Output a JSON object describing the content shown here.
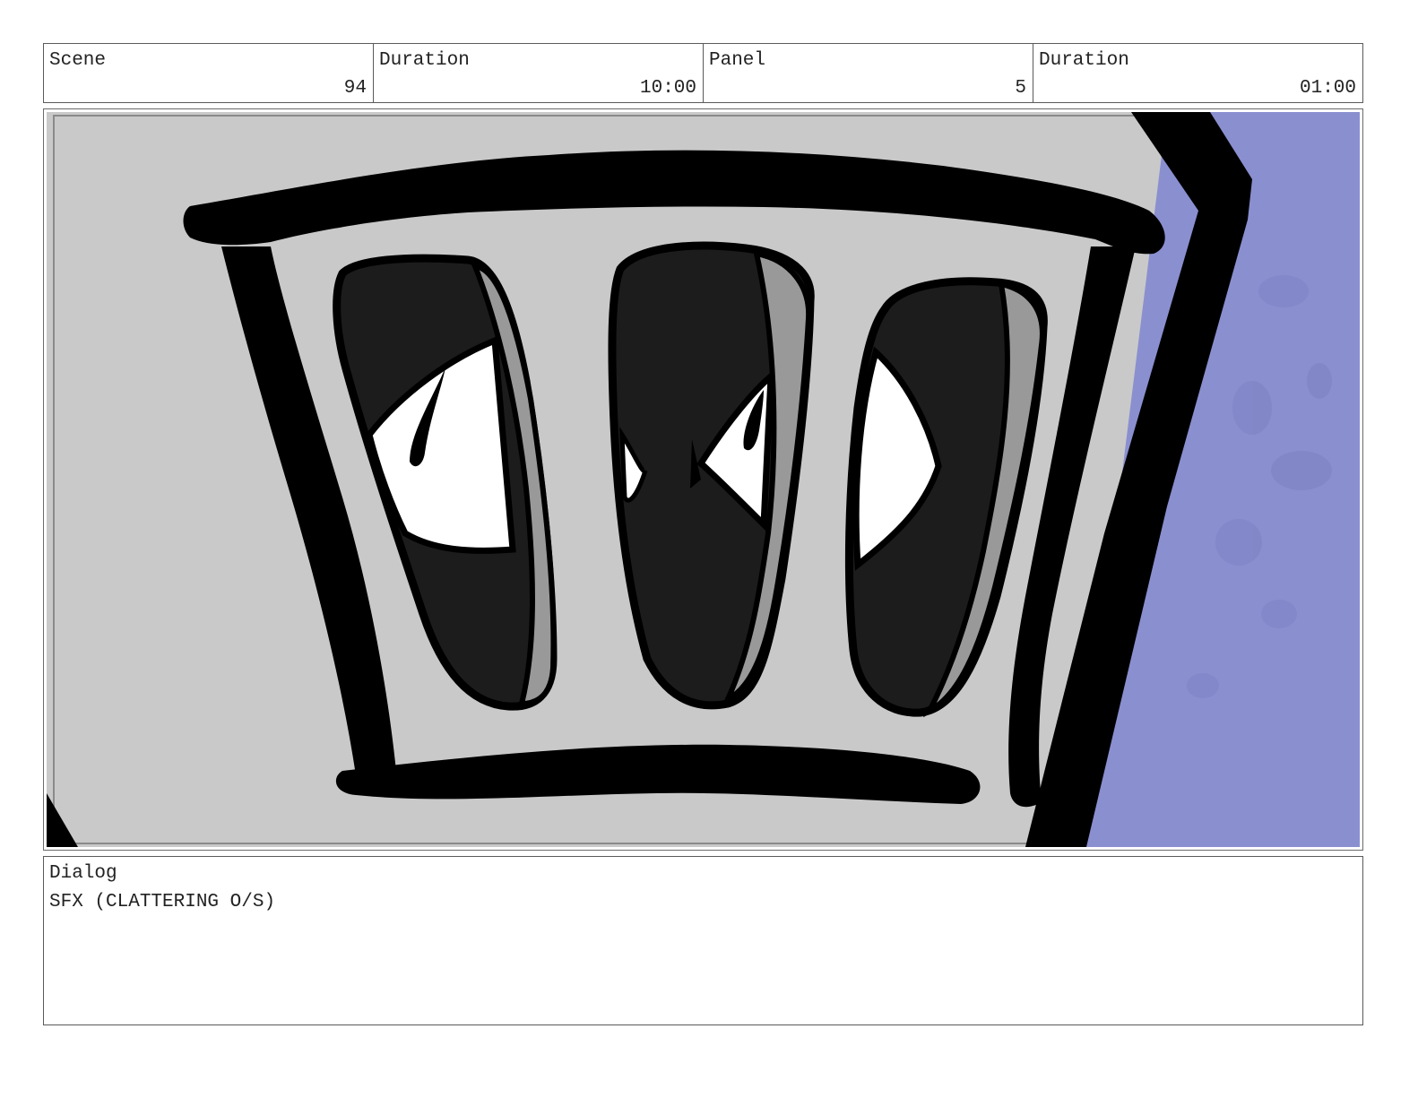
{
  "header": {
    "scene": {
      "label": "Scene",
      "value": "94"
    },
    "scene_duration": {
      "label": "Duration",
      "value": "10:00"
    },
    "panel": {
      "label": "Panel",
      "value": "5"
    },
    "panel_duration": {
      "label": "Duration",
      "value": "01:00"
    }
  },
  "panel_image": {
    "subject": "toaster-face-closeup",
    "colors": {
      "background": "#c9c9c9",
      "ink": "#000000",
      "slot_fill": "#1c1c1c",
      "slot_highlight": "#999999",
      "eye_white": "#ffffff",
      "sky": "#8a8fd0"
    }
  },
  "dialog": {
    "label": "Dialog",
    "text": "SFX (CLATTERING O/S)"
  }
}
